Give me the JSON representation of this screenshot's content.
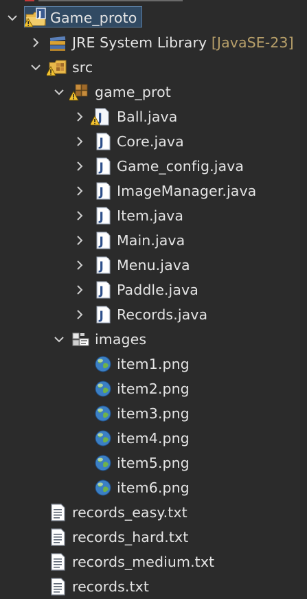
{
  "tree": {
    "project": {
      "label": "Game_proto"
    },
    "jre": {
      "label": "JRE System Library",
      "decoration": "[JavaSE-23]"
    },
    "src": {
      "label": "src"
    },
    "package": {
      "label": "game_prot"
    },
    "java_files": [
      "Ball.java",
      "Core.java",
      "Game_config.java",
      "ImageManager.java",
      "Item.java",
      "Main.java",
      "Menu.java",
      "Paddle.java",
      "Records.java"
    ],
    "images_folder": {
      "label": "images"
    },
    "image_files": [
      "item1.png",
      "item2.png",
      "item3.png",
      "item4.png",
      "item5.png",
      "item6.png"
    ],
    "text_files": [
      "records_easy.txt",
      "records_hard.txt",
      "records_medium.txt",
      "records.txt"
    ]
  },
  "icons": {
    "expand": "chevron-down-icon",
    "collapse": "chevron-right-icon",
    "project": "java-project-icon",
    "library": "library-icon",
    "source": "source-folder-icon",
    "package": "package-icon",
    "java": "java-file-icon",
    "folder": "folder-icon",
    "image": "image-file-icon",
    "text": "text-file-icon",
    "warning": "warning-icon"
  },
  "colors": {
    "background": "#2b2b2b",
    "text": "#e4e4e4",
    "decoration": "#b8a06a",
    "selection": "#314a63"
  }
}
